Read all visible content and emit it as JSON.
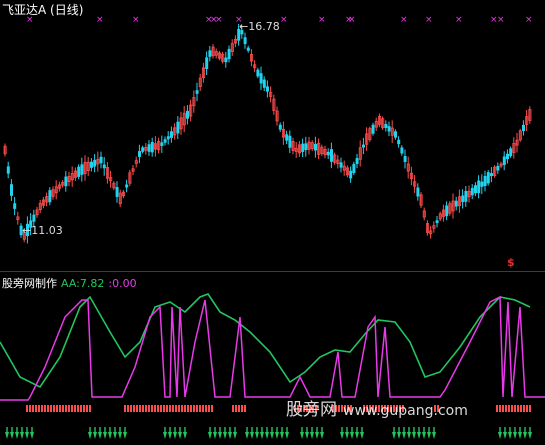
{
  "main_chart": {
    "title": "飞亚达A (日线)",
    "high_label": "16.78",
    "low_label": "11.03",
    "signal_mark": "$",
    "colors": {
      "up": "#ff4d4d",
      "down": "#22d3ee",
      "marker": "#e83ae8"
    }
  },
  "sub_chart": {
    "name": "股旁网制作",
    "aa_label": "AA:7.82",
    "second_label": ":0.00",
    "colors": {
      "aa_line": "#22c55e",
      "step_line": "#e83ae8",
      "bar_red": "#ff4d4d",
      "arrow": "#22c55e"
    }
  },
  "watermark": {
    "text": "股旁网",
    "url": "www.gupang.com"
  }
}
